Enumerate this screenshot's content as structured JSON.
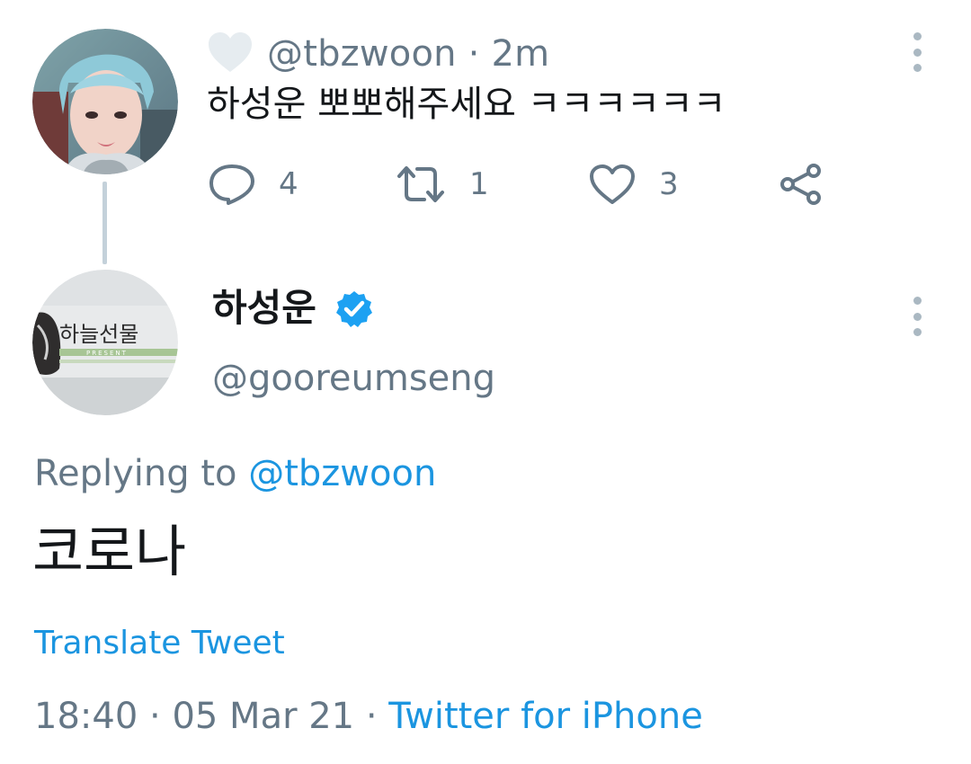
{
  "parent_tweet": {
    "handle": "@tbzwoon",
    "separator": "·",
    "age": "2m",
    "text": "하성운 뽀뽀해주세요 ㅋㅋㅋㅋㅋㅋ",
    "actions": {
      "reply_count": "4",
      "retweet_count": "1",
      "like_count": "3"
    },
    "avatar_icon": "user-avatar-photo"
  },
  "main_tweet": {
    "display_name": "하성운",
    "handle": "@gooreumseng",
    "verified_icon": "verified-badge-icon",
    "avatar_text": "하늘선물",
    "avatar_subtext": "PRESENT",
    "replying_prefix": "Replying to",
    "replying_mention": "@tbzwoon",
    "text": "코로나",
    "translate_label": "Translate Tweet",
    "time": "18:40",
    "date": "05 Mar 21",
    "dot": "·",
    "source": "Twitter for iPhone"
  },
  "colors": {
    "accent": "#1b95e0",
    "secondary_text": "#657786",
    "primary_text": "#14171a",
    "thread_line": "#c4d1da"
  }
}
